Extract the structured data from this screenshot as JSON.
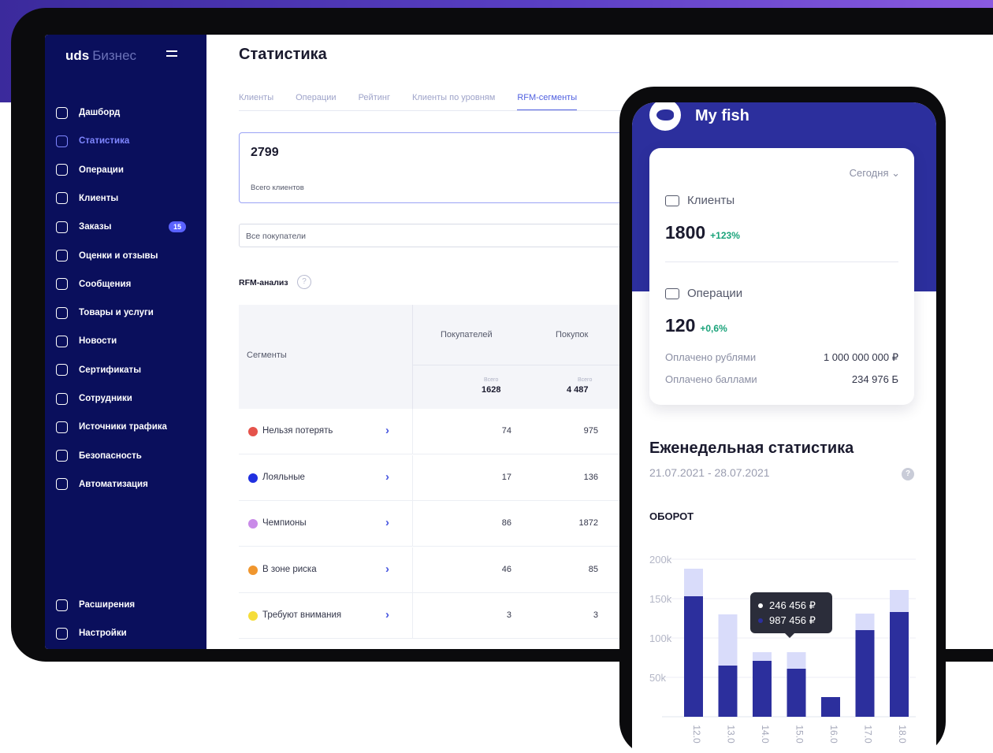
{
  "sidebar": {
    "brand": "uds",
    "brand_sub": "Бизнес",
    "items": [
      {
        "label": "Дашборд",
        "icon": "dashboard-icon"
      },
      {
        "label": "Статистика",
        "icon": "chart-icon",
        "active": true
      },
      {
        "label": "Операции",
        "icon": "wallet-icon"
      },
      {
        "label": "Клиенты",
        "icon": "users-icon"
      },
      {
        "label": "Заказы",
        "icon": "orders-icon",
        "badge": "15"
      },
      {
        "label": "Оценки и отзывы",
        "icon": "review-icon"
      },
      {
        "label": "Сообщения",
        "icon": "message-icon"
      },
      {
        "label": "Товары и услуги",
        "icon": "bag-icon"
      },
      {
        "label": "Новости",
        "icon": "news-icon"
      },
      {
        "label": "Сертификаты",
        "icon": "ticket-icon"
      },
      {
        "label": "Сотрудники",
        "icon": "person-icon"
      },
      {
        "label": "Источники трафика",
        "icon": "globe-icon"
      },
      {
        "label": "Безопасность",
        "icon": "shield-icon"
      },
      {
        "label": "Автоматизация",
        "icon": "robot-icon"
      }
    ],
    "bottom": [
      {
        "label": "Расширения",
        "icon": "extensions-icon"
      },
      {
        "label": "Настройки",
        "icon": "gear-icon"
      }
    ]
  },
  "main": {
    "title": "Статистика",
    "tabs": [
      "Клиенты",
      "Операции",
      "Рейтинг",
      "Клиенты по уровням",
      "RFM-сегменты"
    ],
    "kpi": {
      "value": "2799",
      "label": "Всего клиентов"
    },
    "filter": "Все покупатели",
    "rfm_title": "RFM-анализ",
    "table": {
      "col_segments": "Сегменты",
      "col_buyers": "Покупателей",
      "col_purchases": "Покупок",
      "total_label": "Всего",
      "total_buyers": "1628",
      "total_purchases": "4 487",
      "rows": [
        {
          "name": "Нельзя потерять",
          "buyers": "74",
          "purchases": "975",
          "color": "#e5534b"
        },
        {
          "name": "Лояльные",
          "buyers": "17",
          "purchases": "136",
          "color": "#2030e0"
        },
        {
          "name": "Чемпионы",
          "buyers": "86",
          "purchases": "1872",
          "color": "#c98ae8"
        },
        {
          "name": "В зоне риска",
          "buyers": "46",
          "purchases": "85",
          "color": "#f0962e"
        },
        {
          "name": "Требуют внимания",
          "buyers": "3",
          "purchases": "3",
          "color": "#f5dd3a"
        }
      ]
    }
  },
  "phone": {
    "title": "My fish",
    "period": "Сегодня",
    "clients_label": "Клиенты",
    "clients_value": "1800",
    "clients_growth": "+123%",
    "ops_label": "Операции",
    "ops_value": "120",
    "ops_growth": "+0,6%",
    "paid_rub_label": "Оплачено рублями",
    "paid_rub_value": "1 000 000 000 ₽",
    "paid_pts_label": "Оплачено баллами",
    "paid_pts_value": "234 976 Б",
    "weekly_title": "Еженедельная статистика",
    "dates": "21.07.2021 - 28.07.2021",
    "turnover_label": "ОБОРОТ",
    "tooltip_line1": "246 456 ₽",
    "tooltip_line2": "987 456 ₽"
  },
  "chart_data": {
    "type": "bar",
    "title": "ОБОРОТ",
    "categories": [
      "12.0",
      "13.0",
      "14.0",
      "15.0",
      "16.0",
      "17.0",
      "18.0"
    ],
    "series": [
      {
        "values": [
          153,
          65,
          71,
          61,
          25,
          110,
          133
        ],
        "color": "#2c2f9d"
      },
      {
        "values": [
          35,
          65,
          11,
          21,
          0,
          21,
          28
        ],
        "color": "#d9dcfa"
      }
    ],
    "stacked": true,
    "yticks": [
      "200k",
      "150k",
      "100k",
      "50k"
    ],
    "ylim": [
      0,
      200
    ]
  }
}
